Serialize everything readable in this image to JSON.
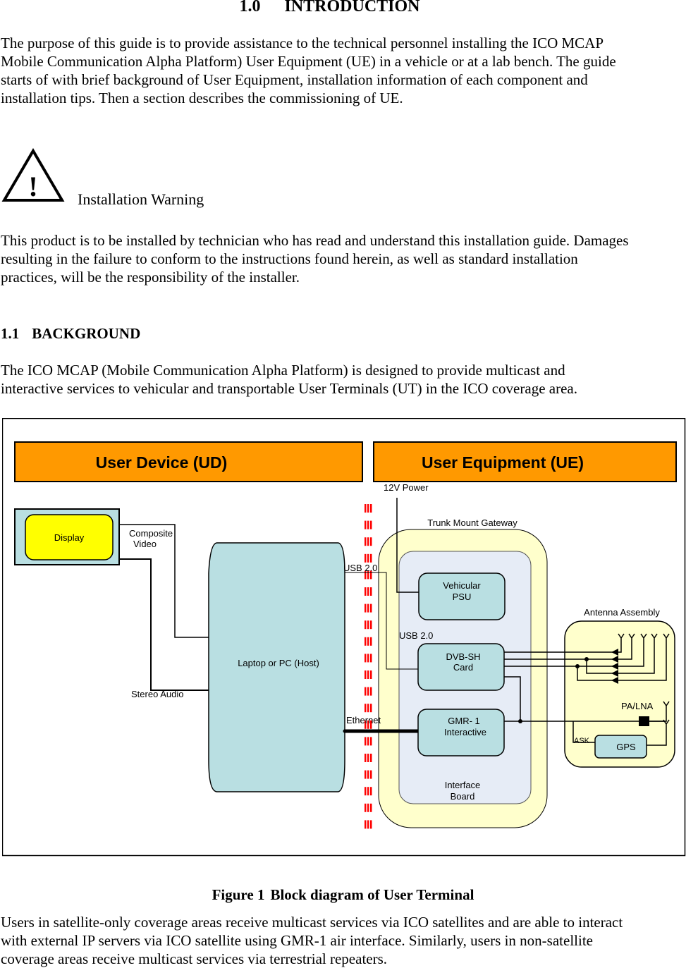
{
  "heading": {
    "number": "1.0",
    "title": "INTRODUCTION"
  },
  "intro_paragraph": [
    "The purpose of this guide is to provide assistance to the technical personnel installing the ICO MCAP",
    "Mobile Communication Alpha Platform) User Equipment (UE) in a vehicle or at a lab bench. The guide",
    "starts of with brief background of User Equipment, installation information of each component and",
    "installation tips. Then a section describes the commissioning of UE."
  ],
  "warning": {
    "icon": "warning-triangle-icon",
    "symbol": "!",
    "title": "Installation Warning",
    "text": [
      "This product is to be installed by technician who has read and understand this installation guide. Damages",
      "resulting in the failure to conform to the instructions found herein, as well as standard installation",
      "practices, will be the responsibility of the installer."
    ]
  },
  "section": {
    "number": "1.1",
    "title": "BACKGROUND"
  },
  "background_paragraph": [
    "The ICO MCAP (Mobile Communication Alpha Platform) is designed to provide multicast and",
    "interactive services to vehicular and transportable User Terminals (UT) in the ICO coverage area."
  ],
  "diagram": {
    "colors": {
      "banner": "#ff9900",
      "block": "#b9dfe2",
      "display": "#ffff00",
      "gateway": "#ffffcc",
      "interface_board": "#e6ecf6",
      "divider": "#ff0000"
    },
    "banners": {
      "ud": "User Device (UD)",
      "ue": "User Equipment (UE)"
    },
    "display": "Display",
    "composite_video": [
      "Composite",
      "Video"
    ],
    "stereo_audio": "Stereo Audio",
    "host": "Laptop or  PC (Host)",
    "usb_host": "USB 2.0",
    "usb_card": "USB 2.0",
    "ethernet": "Ethernet",
    "power": "12V Power",
    "gateway_title": "Trunk Mount Gateway",
    "psu": [
      "Vehicular",
      "PSU"
    ],
    "dvb": [
      "DVB-SH",
      "Card"
    ],
    "gmr": [
      "GMR- 1",
      "Interactive"
    ],
    "interface_board": [
      "Interface",
      "Board"
    ],
    "antenna_title": "Antenna Assembly",
    "pa_lna": "PA/LNA",
    "ask": "ASK",
    "gps": "GPS"
  },
  "figure_caption": {
    "label": "Figure 1",
    "title": "Block diagram of User Terminal"
  },
  "closing_paragraph": [
    "Users in satellite-only coverage areas receive multicast services via ICO satellites and are able to interact",
    "with external IP servers via ICO satellite using GMR-1 air interface. Similarly, users in non-satellite",
    "coverage areas receive multicast services via terrestrial repeaters."
  ]
}
